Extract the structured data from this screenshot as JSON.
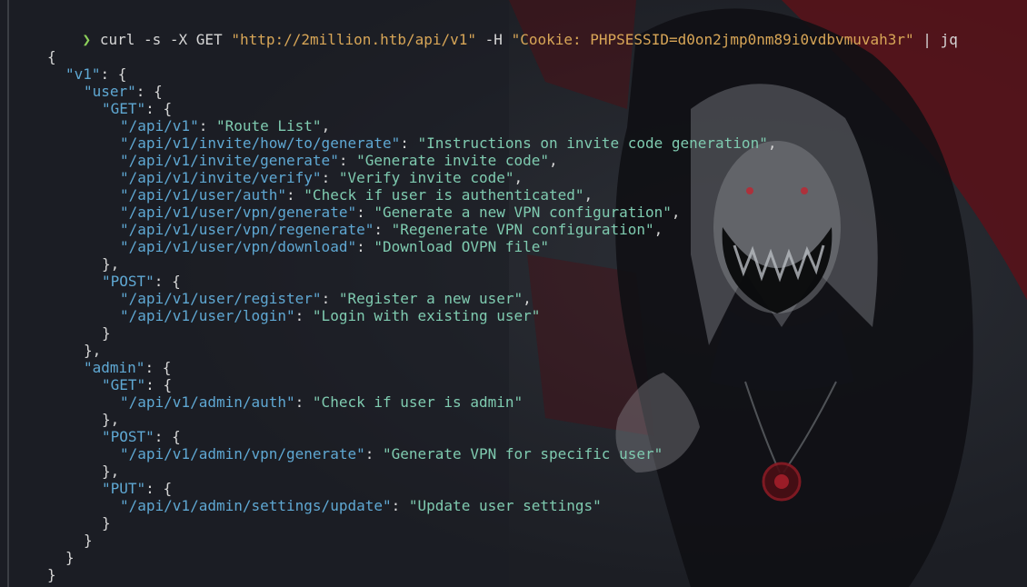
{
  "terminal": {
    "prompt_symbol": "❯",
    "command": "curl",
    "flags": " -s -X GET ",
    "url": "\"http://2million.htb/api/v1\"",
    "header_flag": " -H ",
    "cookie": "\"Cookie: PHPSESSID=d0on2jmp0nm89i0vdbvmuvah3r\"",
    "pipe": " | ",
    "jq": "jq"
  },
  "output": {
    "lines": [
      {
        "indent": 0,
        "key": "",
        "value": "",
        "text": "{"
      },
      {
        "indent": 1,
        "key": "\"v1\"",
        "value": "",
        "text": ": {"
      },
      {
        "indent": 2,
        "key": "\"user\"",
        "value": "",
        "text": ": {"
      },
      {
        "indent": 3,
        "key": "\"GET\"",
        "value": "",
        "text": ": {"
      },
      {
        "indent": 4,
        "key": "\"/api/v1\"",
        "value": "\"Route List\"",
        "text": ","
      },
      {
        "indent": 4,
        "key": "\"/api/v1/invite/how/to/generate\"",
        "value": "\"Instructions on invite code generation\"",
        "text": ","
      },
      {
        "indent": 4,
        "key": "\"/api/v1/invite/generate\"",
        "value": "\"Generate invite code\"",
        "text": ","
      },
      {
        "indent": 4,
        "key": "\"/api/v1/invite/verify\"",
        "value": "\"Verify invite code\"",
        "text": ","
      },
      {
        "indent": 4,
        "key": "\"/api/v1/user/auth\"",
        "value": "\"Check if user is authenticated\"",
        "text": ","
      },
      {
        "indent": 4,
        "key": "\"/api/v1/user/vpn/generate\"",
        "value": "\"Generate a new VPN configuration\"",
        "text": ","
      },
      {
        "indent": 4,
        "key": "\"/api/v1/user/vpn/regenerate\"",
        "value": "\"Regenerate VPN configuration\"",
        "text": ","
      },
      {
        "indent": 4,
        "key": "\"/api/v1/user/vpn/download\"",
        "value": "\"Download OVPN file\"",
        "text": ""
      },
      {
        "indent": 3,
        "key": "",
        "value": "",
        "text": "},"
      },
      {
        "indent": 3,
        "key": "\"POST\"",
        "value": "",
        "text": ": {"
      },
      {
        "indent": 4,
        "key": "\"/api/v1/user/register\"",
        "value": "\"Register a new user\"",
        "text": ","
      },
      {
        "indent": 4,
        "key": "\"/api/v1/user/login\"",
        "value": "\"Login with existing user\"",
        "text": ""
      },
      {
        "indent": 3,
        "key": "",
        "value": "",
        "text": "}"
      },
      {
        "indent": 2,
        "key": "",
        "value": "",
        "text": "},"
      },
      {
        "indent": 2,
        "key": "\"admin\"",
        "value": "",
        "text": ": {"
      },
      {
        "indent": 3,
        "key": "\"GET\"",
        "value": "",
        "text": ": {"
      },
      {
        "indent": 4,
        "key": "\"/api/v1/admin/auth\"",
        "value": "\"Check if user is admin\"",
        "text": ""
      },
      {
        "indent": 3,
        "key": "",
        "value": "",
        "text": "},"
      },
      {
        "indent": 3,
        "key": "\"POST\"",
        "value": "",
        "text": ": {"
      },
      {
        "indent": 4,
        "key": "\"/api/v1/admin/vpn/generate\"",
        "value": "\"Generate VPN for specific user\"",
        "text": ""
      },
      {
        "indent": 3,
        "key": "",
        "value": "",
        "text": "},"
      },
      {
        "indent": 3,
        "key": "\"PUT\"",
        "value": "",
        "text": ": {"
      },
      {
        "indent": 4,
        "key": "\"/api/v1/admin/settings/update\"",
        "value": "\"Update user settings\"",
        "text": ""
      },
      {
        "indent": 3,
        "key": "",
        "value": "",
        "text": "}"
      },
      {
        "indent": 2,
        "key": "",
        "value": "",
        "text": "}"
      },
      {
        "indent": 1,
        "key": "",
        "value": "",
        "text": "}"
      },
      {
        "indent": 0,
        "key": "",
        "value": "",
        "text": "}"
      }
    ]
  },
  "colors": {
    "background": "#1c1e24",
    "prompt": "#8ccf5a",
    "string_literal": "#d8a657",
    "json_key": "#5fa8d3",
    "json_value": "#7fcbb0",
    "text": "#d6d6d6",
    "accent_red": "#7a1a22"
  }
}
